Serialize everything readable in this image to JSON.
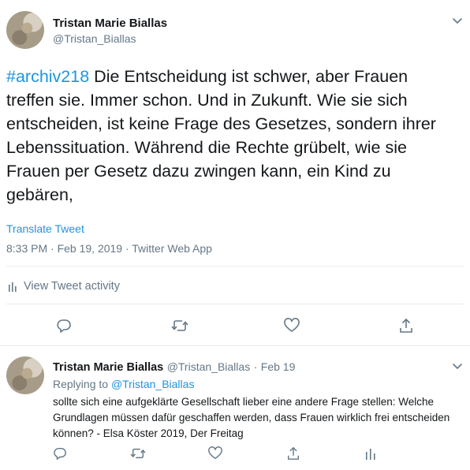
{
  "main_tweet": {
    "author_name": "Tristan Marie Biallas",
    "author_handle": "@Tristan_Biallas",
    "hashtag": "#archiv218",
    "text": " Die Entscheidung ist schwer, aber Frauen treffen sie. Immer schon. Und in Zukunft. Wie sie sich entscheiden, ist keine Frage des Gesetzes, sondern ihrer Lebenssituation. Während die Rechte grübelt, wie sie Frauen per Gesetz dazu zwingen kann, ein Kind zu gebären,",
    "translate_label": "Translate Tweet",
    "timestamp": "8:33 PM · Feb 19, 2019 · Twitter Web App",
    "activity_label": "View Tweet activity"
  },
  "reply_tweet": {
    "author_name": "Tristan Marie Biallas",
    "author_handle": "@Tristan_Biallas",
    "separator": "·",
    "date": "Feb 19",
    "replying_prefix": "Replying to ",
    "replying_to": "@Tristan_Biallas",
    "text": "sollte sich eine aufgeklärte Gesellschaft lieber eine andere Frage stellen: Welche Grundlagen müssen dafür geschaffen werden, dass Frauen wirklich frei entscheiden können? - Elsa Köster 2019, Der Freitag"
  },
  "icons": {
    "caret": "chevron-down-icon",
    "reply": "reply-icon",
    "retweet": "retweet-icon",
    "like": "heart-icon",
    "share": "share-icon",
    "activity": "bar-chart-icon"
  },
  "colors": {
    "accent": "#1b95e0",
    "secondary_text": "#657786",
    "divider": "#e6ecf0"
  }
}
